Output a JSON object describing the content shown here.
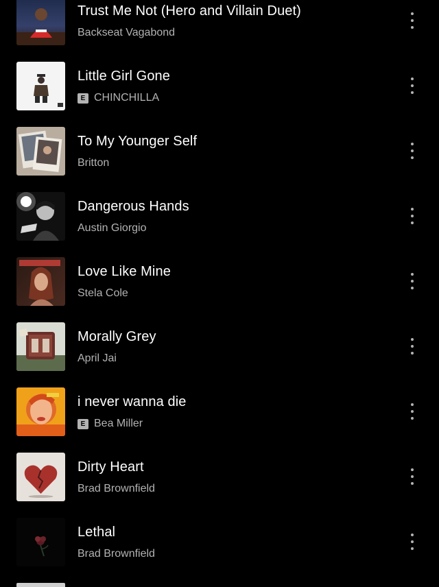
{
  "tracks": [
    {
      "title": "Trust Me Not (Hero and Villain Duet)",
      "artist": "Backseat Vagabond",
      "explicit": false,
      "cover_icon": "album-cover-trust-me-not"
    },
    {
      "title": "Little Girl Gone",
      "artist": "CHINCHILLA",
      "explicit": true,
      "cover_icon": "album-cover-little-girl-gone"
    },
    {
      "title": "To My Younger Self",
      "artist": "Britton",
      "explicit": false,
      "cover_icon": "album-cover-to-my-younger-self"
    },
    {
      "title": "Dangerous Hands",
      "artist": "Austin Giorgio",
      "explicit": false,
      "cover_icon": "album-cover-dangerous-hands"
    },
    {
      "title": "Love Like Mine",
      "artist": "Stela Cole",
      "explicit": false,
      "cover_icon": "album-cover-love-like-mine"
    },
    {
      "title": "Morally Grey",
      "artist": "April Jai",
      "explicit": false,
      "cover_icon": "album-cover-morally-grey"
    },
    {
      "title": "i never wanna die",
      "artist": "Bea Miller",
      "explicit": true,
      "cover_icon": "album-cover-i-never-wanna-die"
    },
    {
      "title": "Dirty Heart",
      "artist": "Brad Brownfield",
      "explicit": false,
      "cover_icon": "album-cover-dirty-heart"
    },
    {
      "title": "Lethal",
      "artist": "Brad Brownfield",
      "explicit": false,
      "cover_icon": "album-cover-lethal"
    }
  ],
  "explicit_label": "E",
  "colors": {
    "background": "#000000",
    "title": "#ffffff",
    "subtitle": "#b3b3b3",
    "explicit_badge": "#b3b3b3"
  },
  "more_options_icon": "more-vertical-icon"
}
